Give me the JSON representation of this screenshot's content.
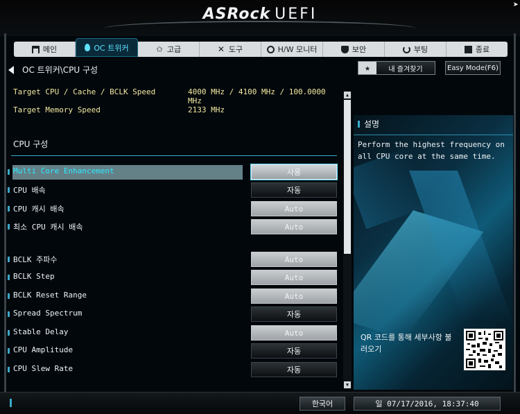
{
  "header": {
    "brand": "ASRock",
    "product": "UEFI"
  },
  "tabs": [
    {
      "label": "메인",
      "icon": "main-icon"
    },
    {
      "label": "OC 트위커",
      "icon": "drop-icon",
      "active": true
    },
    {
      "label": "고급",
      "icon": "star-icon"
    },
    {
      "label": "도구",
      "icon": "tools-icon"
    },
    {
      "label": "H/W 모니터",
      "icon": "monitor-icon"
    },
    {
      "label": "보안",
      "icon": "shield-icon"
    },
    {
      "label": "부팅",
      "icon": "power-icon"
    },
    {
      "label": "종료",
      "icon": "exit-icon"
    }
  ],
  "breadcrumb": "OC 트위커\\CPU 구성",
  "favorites_label": "내 즐겨찾기",
  "easy_mode_label": "Easy Mode(F6)",
  "info": {
    "cpu_label": "Target CPU / Cache / BCLK Speed",
    "cpu_value": "4000 MHz / 4100 MHz / 100.0000 MHz",
    "mem_label": "Target Memory Speed",
    "mem_value": "2133 MHz"
  },
  "section_title": "CPU 구성",
  "settings": [
    {
      "label": "Multi Core Enhancement",
      "value": "사용",
      "style": "sel"
    },
    {
      "label": "CPU 배속",
      "value": "자동",
      "style": "dark"
    },
    {
      "label": "CPU 캐시 배속",
      "value": "Auto",
      "style": "light"
    },
    {
      "label": "최소 CPU 캐시 배속",
      "value": "Auto",
      "style": "light"
    },
    {
      "label": "BCLK 주파수",
      "value": "Auto",
      "style": "light"
    },
    {
      "label": "BCLK Step",
      "value": "Auto",
      "style": "light"
    },
    {
      "label": "BCLK Reset Range",
      "value": "Auto",
      "style": "light"
    },
    {
      "label": "Spread Spectrum",
      "value": "자동",
      "style": "dark"
    },
    {
      "label": "Stable Delay",
      "value": "Auto",
      "style": "light"
    },
    {
      "label": "CPU Amplitude",
      "value": "자동",
      "style": "dark"
    },
    {
      "label": "CPU Slew Rate",
      "value": "자동",
      "style": "dark"
    }
  ],
  "description": {
    "title": "설명",
    "text": "Perform the highest frequency on all CPU core at the same time.",
    "qr_text": "QR 코드를 통해 세부사항 불러오기"
  },
  "footer": {
    "language": "한국어",
    "datetime": "일 07/17/2016, 18:37:40"
  }
}
